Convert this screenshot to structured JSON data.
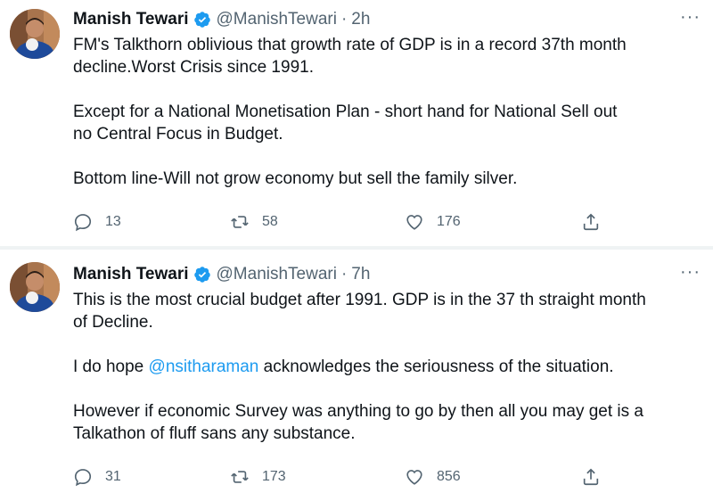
{
  "tweets": [
    {
      "author_name": "Manish Tewari",
      "handle": "@ManishTewari",
      "separator": "·",
      "time": "2h",
      "more": "···",
      "paragraphs": [
        {
          "lines": [
            "FM's Talkthorn oblivious that growth rate of  GDP  is in a record 37th month",
            "decline.Worst Crisis since 1991."
          ]
        },
        {
          "lines": [
            "Except for a National Monetisation Plan - short hand for National Sell out",
            "no Central Focus in Budget."
          ]
        },
        {
          "lines": [
            "Bottom line-Will not grow economy but sell the family silver."
          ]
        }
      ],
      "replies": "13",
      "retweets": "58",
      "likes": "176"
    },
    {
      "author_name": "Manish Tewari",
      "handle": "@ManishTewari",
      "separator": "·",
      "time": "7h",
      "more": "···",
      "p1_line1": "This is the most crucial budget after 1991. GDP is in the 37 th straight month",
      "p1_line2": "of Decline.",
      "p2_before": "I do hope ",
      "p2_mention": "@nsitharaman",
      "p2_after": " acknowledges the seriousness of the situation.",
      "p3_line1": "However if economic Survey was anything to go by then all you may get is a",
      "p3_line2": "Talkathon of fluff sans any substance.",
      "replies": "31",
      "retweets": "173",
      "likes": "856"
    }
  ],
  "colors": {
    "text": "#0f1419",
    "secondary": "#536471",
    "link": "#1d9bf0",
    "verified": "#1d9bf0",
    "divider": "#eff3f4"
  },
  "icons": [
    "verified-badge-icon",
    "reply-icon",
    "retweet-icon",
    "like-icon",
    "share-icon",
    "more-icon"
  ]
}
